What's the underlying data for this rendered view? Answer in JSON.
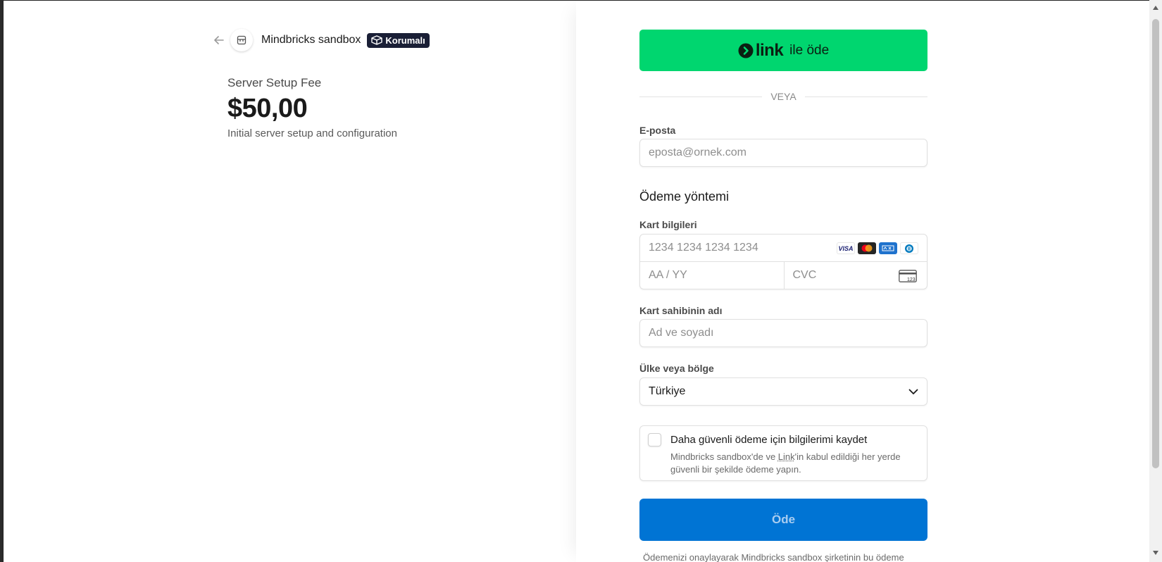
{
  "merchant": {
    "name": "Mindbricks sandbox",
    "badge": "Korumalı"
  },
  "product": {
    "name": "Server Setup Fee",
    "price": "$50,00",
    "description": "Initial server setup and configuration"
  },
  "link_pay": {
    "brand": "link",
    "label": "ile öde"
  },
  "divider": "VEYA",
  "email": {
    "label": "E-posta",
    "placeholder": "eposta@ornek.com"
  },
  "payment_method": {
    "title": "Ödeme yöntemi",
    "card_label": "Kart bilgileri",
    "card_number_placeholder": "1234 1234 1234 1234",
    "expiry_placeholder": "AA / YY",
    "cvc_placeholder": "CVC",
    "brands": [
      "VISA",
      "mastercard",
      "amex",
      "diners"
    ]
  },
  "cardholder": {
    "label": "Kart sahibinin adı",
    "placeholder": "Ad ve soyadı"
  },
  "country": {
    "label": "Ülke veya bölge",
    "value": "Türkiye"
  },
  "save_info": {
    "title": "Daha güvenli ödeme için bilgilerimi kaydet",
    "desc_before": "Mindbricks sandbox'de ve ",
    "desc_link": "Link",
    "desc_after": "'in kabul edildiği her yerde güvenli bir şekilde ödeme yapın."
  },
  "pay_button": "Öde",
  "legal": "Ödemenizi onaylayarak Mindbricks sandbox şirketinin bu ödeme",
  "colors": {
    "link_green": "#00d66f",
    "pay_blue": "#0074d4",
    "badge_bg": "#1a1f36"
  }
}
